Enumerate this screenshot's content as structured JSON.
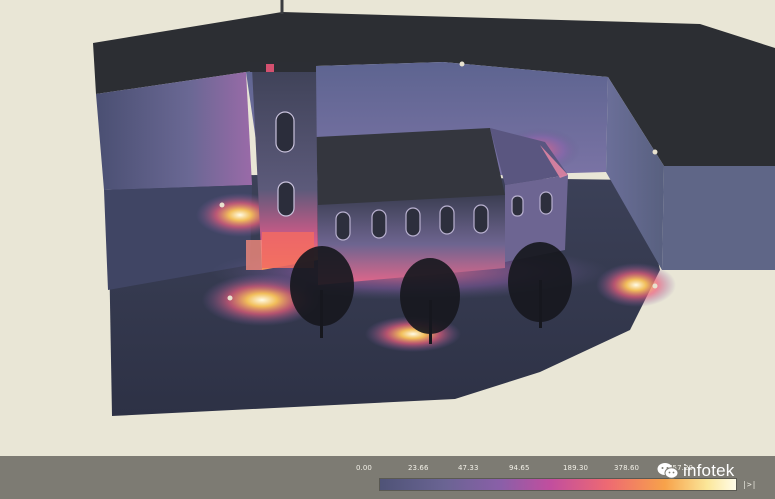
{
  "scene": {
    "description_icon": "church-light-simulation",
    "palette": [
      "#4f5377",
      "#8a5fa8",
      "#c24e9e",
      "#ee6a72",
      "#f7a24a",
      "#fffce9"
    ]
  },
  "legend": {
    "ticks": [
      "0.00",
      "23.66",
      "47.33",
      "94.65",
      "189.30",
      "378.60",
      "757.20"
    ],
    "end_marker_icon": "end-marker-icon",
    "end_marker_glyph": "|>|"
  },
  "brand": {
    "name": "infotek",
    "logo_icon": "wechat-icon"
  }
}
